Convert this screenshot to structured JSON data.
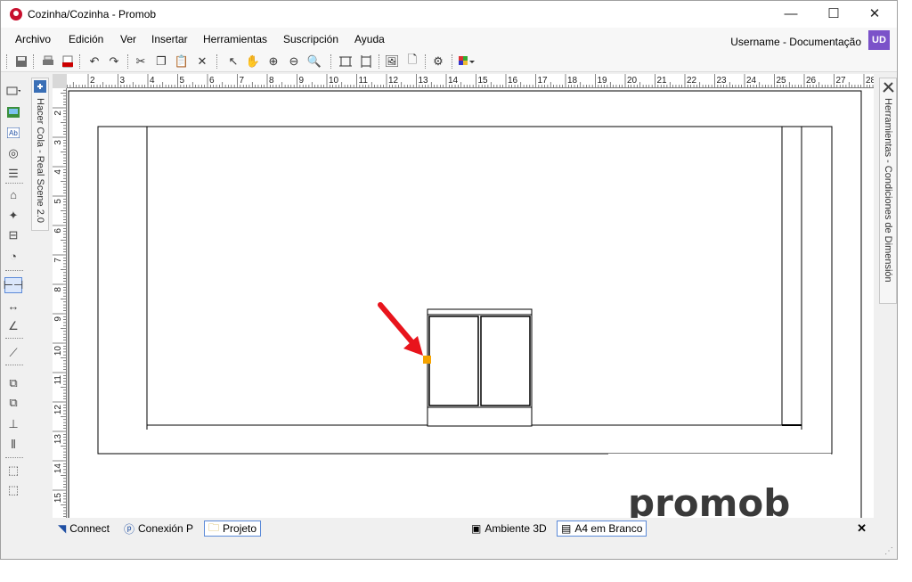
{
  "window": {
    "title": "Cozinha/Cozinha - Promob",
    "minimize_glyph": "—",
    "maximize_glyph": "☐",
    "close_glyph": "✕"
  },
  "menu": {
    "items": [
      "Archivo",
      "Edición",
      "Ver",
      "Insertar",
      "Herramientas",
      "Suscripción",
      "Ayuda"
    ],
    "username": "Username - Documentação",
    "avatar_initials": "UD"
  },
  "toolbar": {
    "icons": [
      "save-icon",
      "print-icon",
      "pdf-icon",
      "undo-icon",
      "redo-icon",
      "cut-icon",
      "copy-icon",
      "paste-icon",
      "delete-icon",
      "select-pointer-icon",
      "pan-hand-icon",
      "zoom-in-icon",
      "zoom-out-icon",
      "zoom-window-icon",
      "fit-page-icon",
      "fit-selection-icon",
      "insert-image-icon",
      "new-page-icon",
      "properties-icon",
      "color-palette-icon"
    ]
  },
  "left_tools": {
    "icons": [
      "rectangle-icon",
      "image-icon",
      "text-icon",
      "symbol-icon",
      "list-icon",
      "view-icon",
      "furniture-icon",
      "frame-icon",
      "measure-icon",
      "dimension-icon",
      "linear-dimension-icon",
      "angle-dimension-icon",
      "draw-line-icon",
      "group-icon",
      "ungroup-icon",
      "align-icon",
      "distribute-icon",
      "bring-front-icon",
      "send-back-icon"
    ]
  },
  "side_tabs": {
    "left": "Hacer Cola - Real Scene 2.0",
    "right": "Herramientas - Condiciones de Dimensión"
  },
  "rulers": {
    "top_labels": [
      "2",
      "3",
      "4",
      "5",
      "6",
      "7",
      "8",
      "9",
      "10",
      "11",
      "12",
      "13",
      "14",
      "15",
      "16",
      "17",
      "18",
      "19",
      "20",
      "21",
      "22",
      "23",
      "24",
      "25",
      "26",
      "27",
      "28"
    ],
    "left_labels": [
      "2",
      "3",
      "4",
      "5",
      "6",
      "7",
      "8",
      "9",
      "10",
      "11",
      "12",
      "13",
      "14",
      "15"
    ]
  },
  "drawing": {
    "watermark": "promob",
    "arrow_color": "#e8141c",
    "handle_color": "#f5a300"
  },
  "statusbar": {
    "connect": "Connect",
    "conexion": "Conexión P",
    "projeto": "Projeto",
    "ambiente": "Ambiente 3D",
    "a4": "A4 em Branco",
    "close_glyph": "✕"
  },
  "colors": {
    "accent": "#7b52c9",
    "active_tab_border": "#5b8ad8"
  }
}
